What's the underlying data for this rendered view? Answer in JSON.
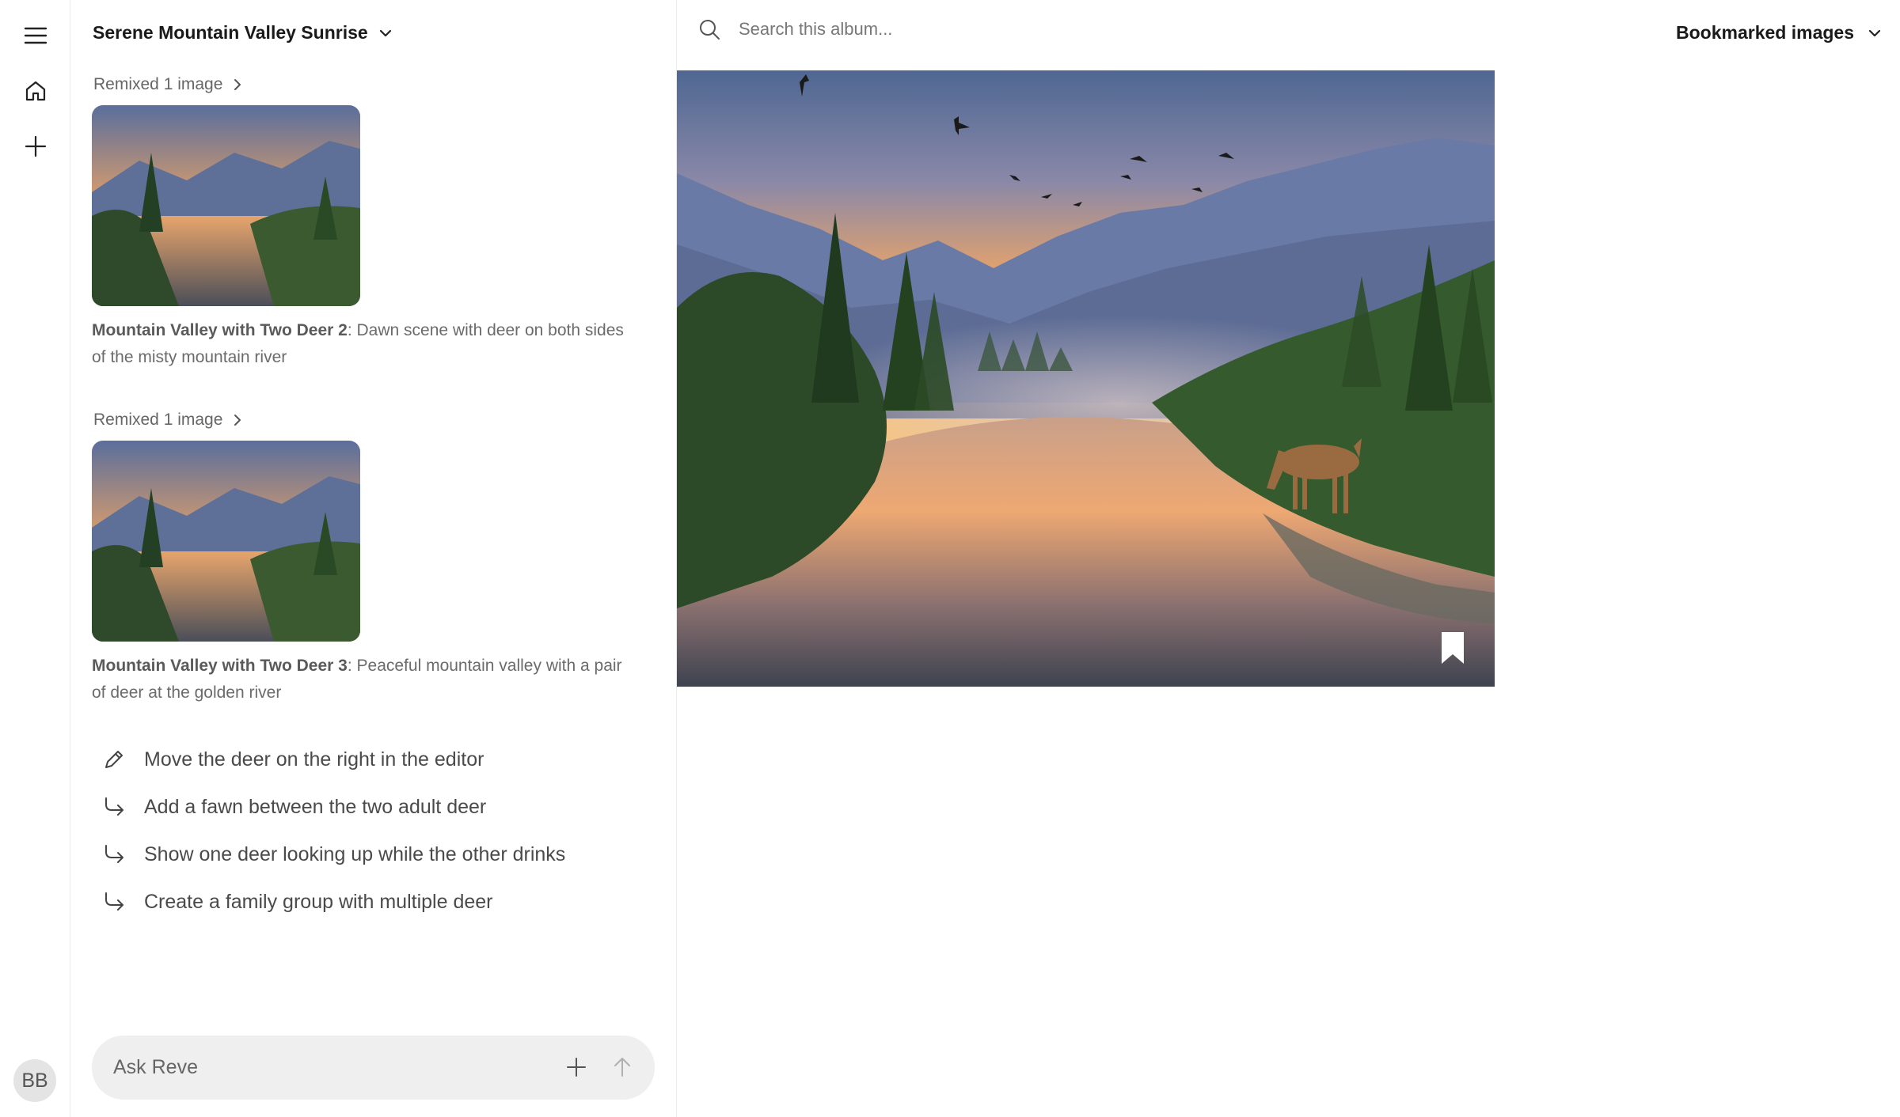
{
  "rail": {
    "avatar_initials": "BB"
  },
  "chat": {
    "album_title": "Serene Mountain Valley Sunrise",
    "entries": [
      {
        "remix_label": "Remixed 1 image",
        "title": "Mountain Valley with Two Deer 2",
        "description": ": Dawn scene with deer on both sides of the misty mountain river"
      },
      {
        "remix_label": "Remixed 1 image",
        "title": "Mountain Valley with Two Deer 3",
        "description": ": Peaceful mountain valley with a pair of deer at the golden river"
      }
    ],
    "suggestions": [
      {
        "icon": "pencil-icon",
        "label": "Move the deer on the right in the editor"
      },
      {
        "icon": "reply-arrow-icon",
        "label": "Add a fawn between the two adult deer"
      },
      {
        "icon": "reply-arrow-icon",
        "label": "Show one deer looking up while the other drinks"
      },
      {
        "icon": "reply-arrow-icon",
        "label": "Create a family group with multiple deer"
      }
    ],
    "composer_placeholder": "Ask Reve"
  },
  "main": {
    "search_placeholder": "Search this album...",
    "filter_label": "Bookmarked images"
  },
  "colors": {
    "border": "#ececec",
    "composer_bg": "#efefef",
    "sky_orange": "#f2a25a",
    "mountain_blue": "#5a6f9a",
    "forest_green": "#2f4f2a"
  }
}
